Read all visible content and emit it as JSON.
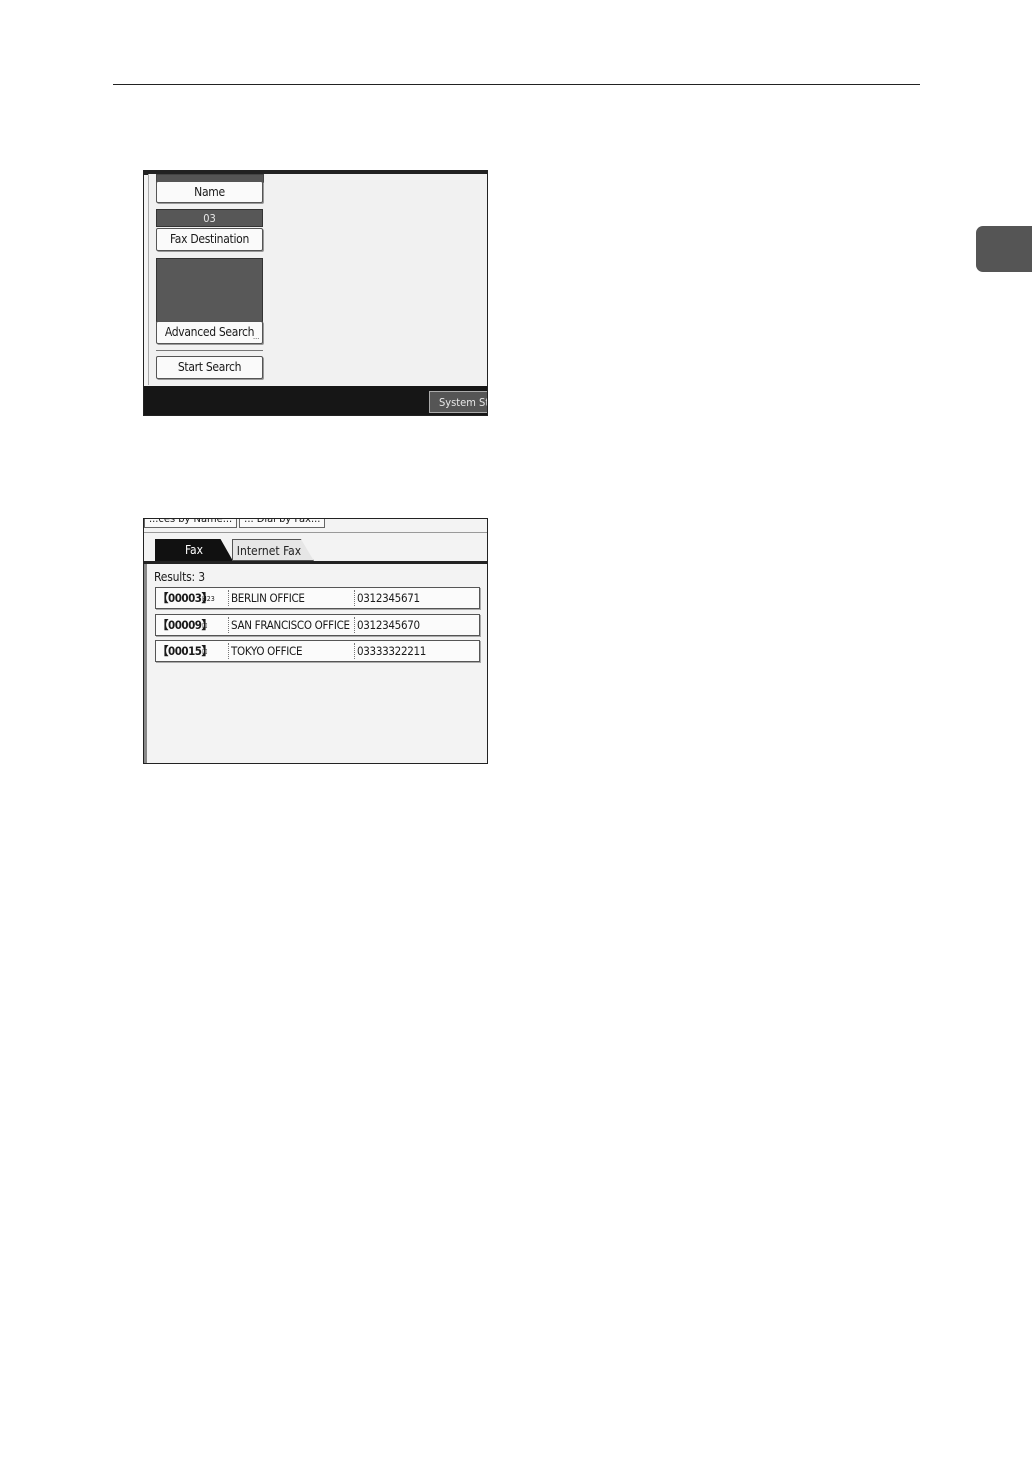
{
  "screen1": {
    "name_button": "Name",
    "fax_value": "03",
    "fax_destination_button": "Fax Destination",
    "advanced_search_button": "Advanced Search",
    "start_search_button": "Start Search",
    "system_status_button": "System Statu"
  },
  "screen2": {
    "cut_tabs": [
      "...ces by Name...",
      "... Dial by Fax..."
    ],
    "tabs": [
      "Fax",
      "Internet Fax"
    ],
    "results_label": "Results: 3",
    "results": [
      {
        "id": "【00003】",
        "mark": "H23",
        "name": "BERLIN OFFICE",
        "number": "0312345671"
      },
      {
        "id": "【00009】",
        "mark": "☐",
        "name": "SAN FRANCISCO OFFICE",
        "number": "0312345670"
      },
      {
        "id": "【00015】",
        "mark": "☐",
        "name": "TOKYO OFFICE",
        "number": "03333322211"
      }
    ]
  }
}
